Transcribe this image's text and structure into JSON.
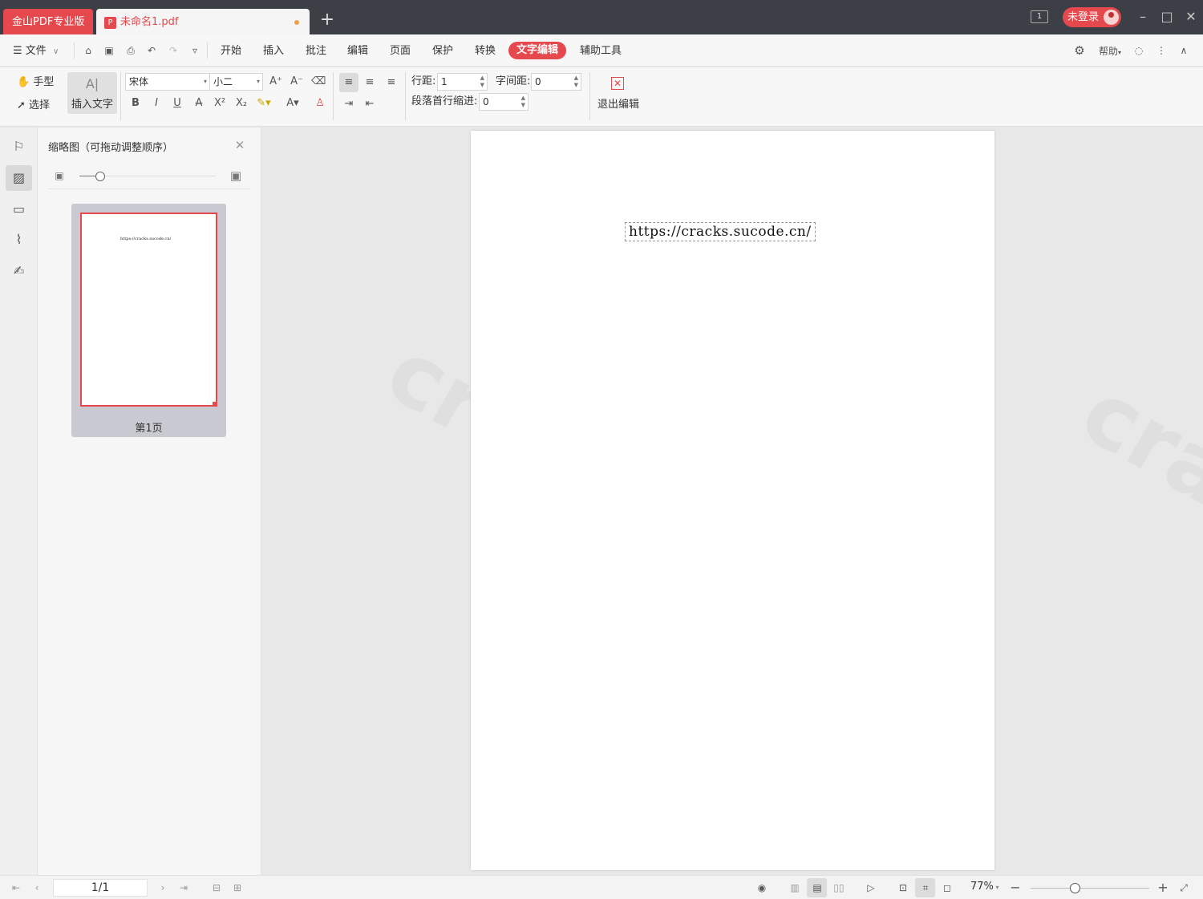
{
  "titlebar": {
    "app_tab": "金山PDF专业版",
    "doc_tab": "未命名1.pdf",
    "new_tab": "+",
    "window_count": "1",
    "login": "未登录"
  },
  "menubar": {
    "file": "文件",
    "tabs": [
      "开始",
      "插入",
      "批注",
      "编辑",
      "页面",
      "保护",
      "转换"
    ],
    "active_tab": "文字编辑",
    "tools_tab": "辅助工具",
    "help": "帮助"
  },
  "ribbon": {
    "hand": "手型",
    "select": "选择",
    "insert_text": "插入文字",
    "font": "宋体",
    "font_size": "小二",
    "line_spacing_label": "行距:",
    "line_spacing_value": "1",
    "char_spacing_label": "字间距:",
    "char_spacing_value": "0",
    "indent_label": "段落首行缩进:",
    "indent_value": "0",
    "exit_edit": "退出编辑"
  },
  "thumbnail_panel": {
    "title": "缩略图（可拖动调整顺序）",
    "page_label": "第1页",
    "slider_level": 0.15
  },
  "document": {
    "text": "https://cracks.sucode.cn/"
  },
  "statusbar": {
    "page_indicator": "1/1",
    "zoom": "77%",
    "zoom_level": 0.38
  },
  "colors": {
    "accent": "#e5484d",
    "titlebar": "#3c3f46"
  }
}
